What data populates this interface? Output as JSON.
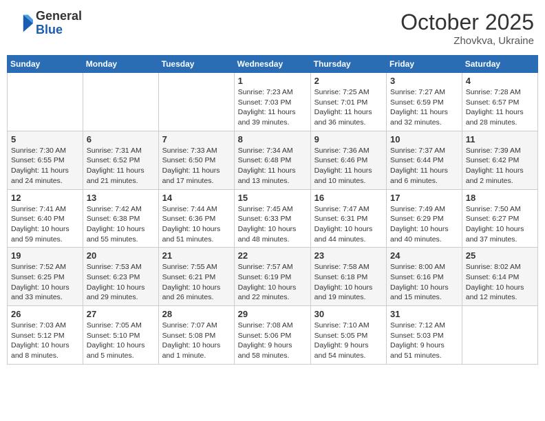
{
  "header": {
    "logo_general": "General",
    "logo_blue": "Blue",
    "month_title": "October 2025",
    "subtitle": "Zhovkva, Ukraine"
  },
  "weekdays": [
    "Sunday",
    "Monday",
    "Tuesday",
    "Wednesday",
    "Thursday",
    "Friday",
    "Saturday"
  ],
  "weeks": [
    [
      {
        "day": "",
        "info": ""
      },
      {
        "day": "",
        "info": ""
      },
      {
        "day": "",
        "info": ""
      },
      {
        "day": "1",
        "info": "Sunrise: 7:23 AM\nSunset: 7:03 PM\nDaylight: 11 hours\nand 39 minutes."
      },
      {
        "day": "2",
        "info": "Sunrise: 7:25 AM\nSunset: 7:01 PM\nDaylight: 11 hours\nand 36 minutes."
      },
      {
        "day": "3",
        "info": "Sunrise: 7:27 AM\nSunset: 6:59 PM\nDaylight: 11 hours\nand 32 minutes."
      },
      {
        "day": "4",
        "info": "Sunrise: 7:28 AM\nSunset: 6:57 PM\nDaylight: 11 hours\nand 28 minutes."
      }
    ],
    [
      {
        "day": "5",
        "info": "Sunrise: 7:30 AM\nSunset: 6:55 PM\nDaylight: 11 hours\nand 24 minutes."
      },
      {
        "day": "6",
        "info": "Sunrise: 7:31 AM\nSunset: 6:52 PM\nDaylight: 11 hours\nand 21 minutes."
      },
      {
        "day": "7",
        "info": "Sunrise: 7:33 AM\nSunset: 6:50 PM\nDaylight: 11 hours\nand 17 minutes."
      },
      {
        "day": "8",
        "info": "Sunrise: 7:34 AM\nSunset: 6:48 PM\nDaylight: 11 hours\nand 13 minutes."
      },
      {
        "day": "9",
        "info": "Sunrise: 7:36 AM\nSunset: 6:46 PM\nDaylight: 11 hours\nand 10 minutes."
      },
      {
        "day": "10",
        "info": "Sunrise: 7:37 AM\nSunset: 6:44 PM\nDaylight: 11 hours\nand 6 minutes."
      },
      {
        "day": "11",
        "info": "Sunrise: 7:39 AM\nSunset: 6:42 PM\nDaylight: 11 hours\nand 2 minutes."
      }
    ],
    [
      {
        "day": "12",
        "info": "Sunrise: 7:41 AM\nSunset: 6:40 PM\nDaylight: 10 hours\nand 59 minutes."
      },
      {
        "day": "13",
        "info": "Sunrise: 7:42 AM\nSunset: 6:38 PM\nDaylight: 10 hours\nand 55 minutes."
      },
      {
        "day": "14",
        "info": "Sunrise: 7:44 AM\nSunset: 6:36 PM\nDaylight: 10 hours\nand 51 minutes."
      },
      {
        "day": "15",
        "info": "Sunrise: 7:45 AM\nSunset: 6:33 PM\nDaylight: 10 hours\nand 48 minutes."
      },
      {
        "day": "16",
        "info": "Sunrise: 7:47 AM\nSunset: 6:31 PM\nDaylight: 10 hours\nand 44 minutes."
      },
      {
        "day": "17",
        "info": "Sunrise: 7:49 AM\nSunset: 6:29 PM\nDaylight: 10 hours\nand 40 minutes."
      },
      {
        "day": "18",
        "info": "Sunrise: 7:50 AM\nSunset: 6:27 PM\nDaylight: 10 hours\nand 37 minutes."
      }
    ],
    [
      {
        "day": "19",
        "info": "Sunrise: 7:52 AM\nSunset: 6:25 PM\nDaylight: 10 hours\nand 33 minutes."
      },
      {
        "day": "20",
        "info": "Sunrise: 7:53 AM\nSunset: 6:23 PM\nDaylight: 10 hours\nand 29 minutes."
      },
      {
        "day": "21",
        "info": "Sunrise: 7:55 AM\nSunset: 6:21 PM\nDaylight: 10 hours\nand 26 minutes."
      },
      {
        "day": "22",
        "info": "Sunrise: 7:57 AM\nSunset: 6:19 PM\nDaylight: 10 hours\nand 22 minutes."
      },
      {
        "day": "23",
        "info": "Sunrise: 7:58 AM\nSunset: 6:18 PM\nDaylight: 10 hours\nand 19 minutes."
      },
      {
        "day": "24",
        "info": "Sunrise: 8:00 AM\nSunset: 6:16 PM\nDaylight: 10 hours\nand 15 minutes."
      },
      {
        "day": "25",
        "info": "Sunrise: 8:02 AM\nSunset: 6:14 PM\nDaylight: 10 hours\nand 12 minutes."
      }
    ],
    [
      {
        "day": "26",
        "info": "Sunrise: 7:03 AM\nSunset: 5:12 PM\nDaylight: 10 hours\nand 8 minutes."
      },
      {
        "day": "27",
        "info": "Sunrise: 7:05 AM\nSunset: 5:10 PM\nDaylight: 10 hours\nand 5 minutes."
      },
      {
        "day": "28",
        "info": "Sunrise: 7:07 AM\nSunset: 5:08 PM\nDaylight: 10 hours\nand 1 minute."
      },
      {
        "day": "29",
        "info": "Sunrise: 7:08 AM\nSunset: 5:06 PM\nDaylight: 9 hours\nand 58 minutes."
      },
      {
        "day": "30",
        "info": "Sunrise: 7:10 AM\nSunset: 5:05 PM\nDaylight: 9 hours\nand 54 minutes."
      },
      {
        "day": "31",
        "info": "Sunrise: 7:12 AM\nSunset: 5:03 PM\nDaylight: 9 hours\nand 51 minutes."
      },
      {
        "day": "",
        "info": ""
      }
    ]
  ]
}
